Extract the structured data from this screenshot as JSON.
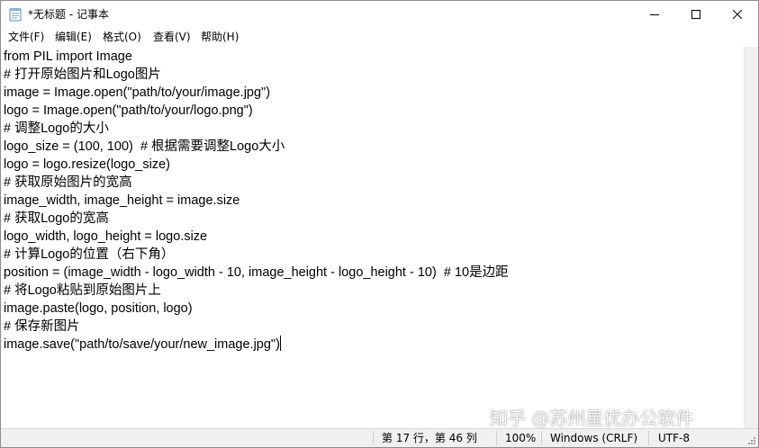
{
  "window": {
    "title": "*无标题 - 记事本"
  },
  "menu": [
    "文件(F)",
    "编辑(E)",
    "格式(O)",
    "查看(V)",
    "帮助(H)"
  ],
  "editor": {
    "lines": [
      "from PIL import Image",
      "# 打开原始图片和Logo图片",
      "image = Image.open(\"path/to/your/image.jpg\")",
      "logo = Image.open(\"path/to/your/logo.png\")",
      "# 调整Logo的大小",
      "logo_size = (100, 100)  # 根据需要调整Logo大小",
      "logo = logo.resize(logo_size)",
      "# 获取原始图片的宽高",
      "image_width, image_height = image.size",
      "# 获取Logo的宽高",
      "logo_width, logo_height = logo.size",
      "# 计算Logo的位置（右下角）",
      "position = (image_width - logo_width - 10, image_height - logo_height - 10)  # 10是边距",
      "# 将Logo粘贴到原始图片上",
      "image.paste(logo, position, logo)",
      "# 保存新图片",
      "image.save(\"path/to/save/your/new_image.jpg\")"
    ]
  },
  "status": {
    "position": "第 17 行，第 46 列",
    "zoom": "100%",
    "line_ending": "Windows (CRLF)",
    "encoding": "UTF-8"
  },
  "watermark": "知乎 @苏州星优办公软件"
}
